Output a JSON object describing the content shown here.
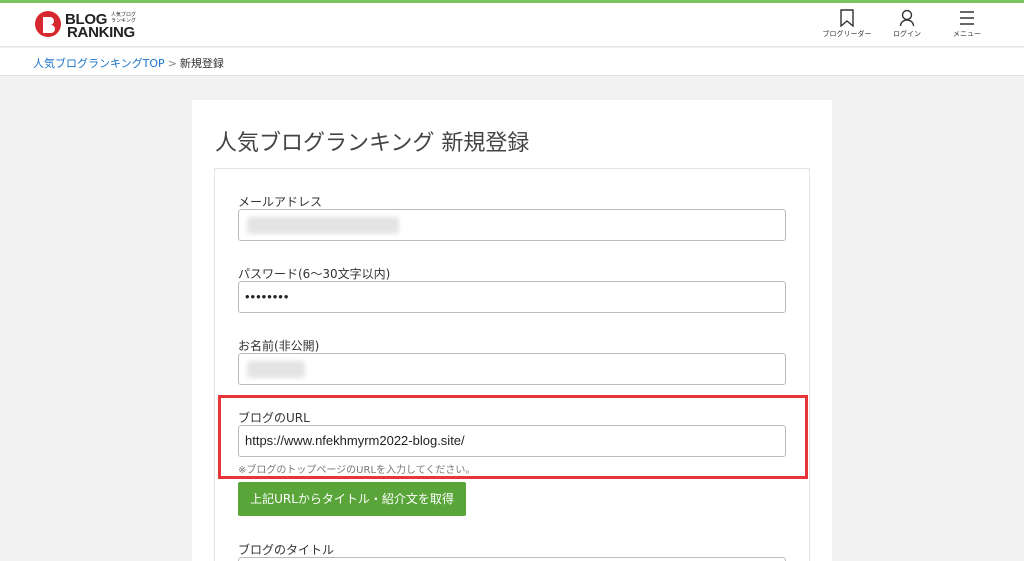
{
  "header": {
    "logo": {
      "line1": "BLOG",
      "line2": "RANKING",
      "small_line1": "人気ブログ",
      "small_line2": "ランキング"
    },
    "nav": [
      {
        "label": "ブログリーダー",
        "icon": "bookmark-icon"
      },
      {
        "label": "ログイン",
        "icon": "user-icon"
      },
      {
        "label": "メニュー",
        "icon": "menu-icon"
      }
    ]
  },
  "breadcrumb": {
    "home": "人気ブログランキングTOP",
    "separator": ">",
    "current": "新規登録"
  },
  "page": {
    "title": "人気ブログランキング 新規登録"
  },
  "form": {
    "email": {
      "label": "メールアドレス",
      "value": ""
    },
    "password": {
      "label": "パスワード(6〜30文字以内)",
      "value": "••••••••"
    },
    "name": {
      "label": "お名前(非公開)",
      "value": ""
    },
    "blog_url": {
      "label": "ブログのURL",
      "value": "https://www.nfekhmyrm2022-blog.site/",
      "hint": "※ブログのトップページのURLを入力してください。"
    },
    "fetch_button_label": "上記URLからタイトル・紹介文を取得",
    "blog_title": {
      "label": "ブログのタイトル"
    }
  },
  "colors": {
    "accent_green": "#5aa53a",
    "top_bar": "#7cc45e",
    "link": "#1a73c9",
    "highlight": "#e8353a"
  }
}
